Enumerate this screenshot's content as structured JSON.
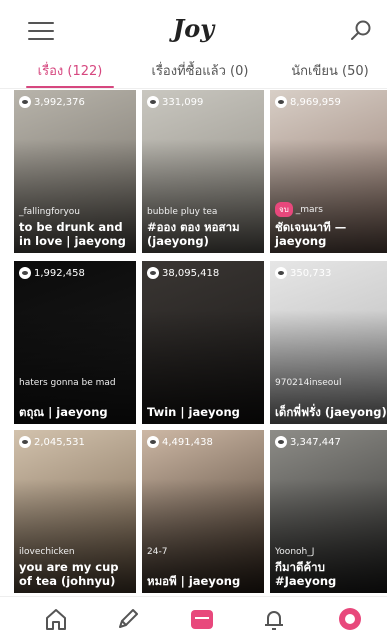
{
  "app": {
    "logo": "Joy"
  },
  "tabs": [
    {
      "label": "เรื่อง (122)",
      "active": true
    },
    {
      "label": "เรื่องที่ซื้อแล้ว (0)",
      "active": false
    },
    {
      "label": "นักเขียน (50)",
      "active": false
    }
  ],
  "stories": [
    {
      "views": "3,992,376",
      "author": "_fallingforyou",
      "title": "to be drunk and in love | jaeyong",
      "bg": [
        "#b8b4ab",
        "#6f6a62"
      ]
    },
    {
      "views": "331,099",
      "author": "bubble pluy tea",
      "title": "#ออง ตอง หอสาม (jaeyong)",
      "bg": [
        "#c9c7c0",
        "#8a867d"
      ]
    },
    {
      "views": "8,969,959",
      "author": "_mars",
      "badge": "จบ",
      "title": "ชัดเจนนาที — jaeyong",
      "bg": [
        "#d8cfc7",
        "#8b6f63"
      ]
    },
    {
      "views": "1,992,458",
      "author": "haters gonna be mad",
      "title": "ตถุณ | jaeyong",
      "bg": [
        "#0b0b0b",
        "#1c1c1c"
      ]
    },
    {
      "views": "38,095,418",
      "author": "",
      "title": "Twin | jaeyong",
      "bg": [
        "#3a3633",
        "#1b1918"
      ]
    },
    {
      "views": "350,733",
      "author": "970214inseoul",
      "title": "เด็กพี่ฟรั่ง (jaeyong)",
      "bg": [
        "#e6e6e6",
        "#b2b2b2"
      ]
    },
    {
      "views": "2,045,531",
      "author": "ilovechicken",
      "title": "you are my cup of tea (johnyu)",
      "bg": [
        "#d2c2ad",
        "#6e5a45"
      ]
    },
    {
      "views": "4,491,438",
      "author": "24-7",
      "title": "หมอพี | jaeyong",
      "bg": [
        "#cdb8a5",
        "#3b2d22"
      ]
    },
    {
      "views": "3,347,447",
      "author": "Yoonoh_J",
      "title": "กีมาดีค้าบ #Jaeyong",
      "bg": [
        "#8e8d88",
        "#2a2a29"
      ]
    }
  ]
}
